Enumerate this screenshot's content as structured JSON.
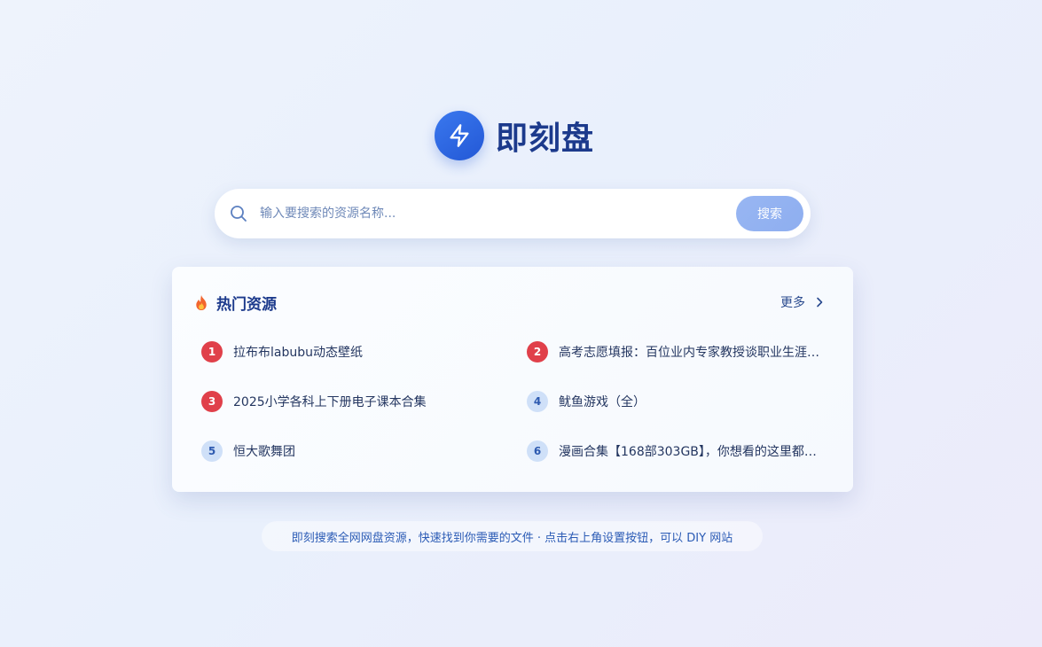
{
  "logo": {
    "text": "即刻盘",
    "icon": "lightning-icon"
  },
  "search": {
    "placeholder": "输入要搜索的资源名称...",
    "value": "",
    "button_label": "搜索",
    "icon": "search-icon"
  },
  "hot": {
    "title": "热门资源",
    "title_icon": "fire-icon",
    "more_label": "更多",
    "more_icon": "chevron-right-icon",
    "items": [
      {
        "rank": "1",
        "title": "拉布布labubu动态壁纸"
      },
      {
        "rank": "2",
        "title": "高考志愿填报：百位业内专家教授谈职业生涯…"
      },
      {
        "rank": "3",
        "title": "2025小学各科上下册电子课本合集"
      },
      {
        "rank": "4",
        "title": "鱿鱼游戏（全）"
      },
      {
        "rank": "5",
        "title": "恒大歌舞团"
      },
      {
        "rank": "6",
        "title": "漫画合集【168部303GB】，你想看的这里都…"
      }
    ]
  },
  "footer": {
    "tip": "即刻搜索全网网盘资源，快速找到你需要的文件 · 点击右上角设置按钮，可以 DIY 网站"
  },
  "colors": {
    "brand": "#2358d6",
    "title": "#1c3a8c",
    "rank_top": "#e0404a",
    "rank_normal_bg": "#cfe0f8",
    "rank_normal_text": "#2d5ab0",
    "search_button": "#98b6f2"
  }
}
